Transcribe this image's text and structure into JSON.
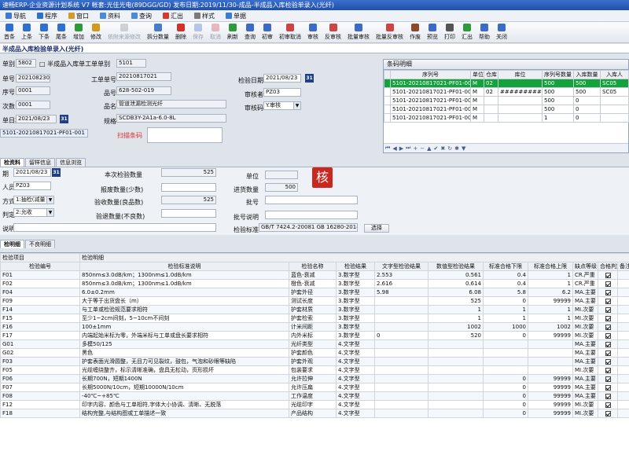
{
  "window": {
    "title": "速畅ERP-企业资源计划系统 V7 帐套:光佳光电(89DGG/GD) 发布日期:2019/11/30-成品-半成品入库检验单录入(光纤)"
  },
  "menu": [
    {
      "label": "导航",
      "icon": "nav-icon",
      "color": "#3d7bd6"
    },
    {
      "label": "程序",
      "icon": "program-icon",
      "color": "#2f6fc7"
    },
    {
      "label": "窗口",
      "icon": "window-icon",
      "color": "#d69a2c"
    },
    {
      "label": "资料",
      "icon": "data-icon",
      "color": "#4a8ad8"
    },
    {
      "label": "查询",
      "icon": "query-icon",
      "color": "#4a8ad8"
    },
    {
      "label": "汇出",
      "icon": "export-icon",
      "color": "#d43a2f"
    },
    {
      "label": "样式",
      "icon": "style-icon",
      "color": "#7a7a7a"
    },
    {
      "label": "单据",
      "icon": "bill-icon",
      "color": "#3d7bd6"
    }
  ],
  "toolbar": [
    {
      "label": "首条",
      "icon": "first-icon",
      "color": "#2e6fcf",
      "enabled": true
    },
    {
      "label": "上条",
      "icon": "prev-icon",
      "color": "#2e6fcf",
      "enabled": true
    },
    {
      "label": "下条",
      "icon": "next-icon",
      "color": "#2e6fcf",
      "enabled": true
    },
    {
      "label": "尾条",
      "icon": "last-icon",
      "color": "#2e6fcf",
      "enabled": true
    },
    {
      "label": "增加",
      "icon": "add-icon",
      "color": "#2f9a3c",
      "enabled": true
    },
    {
      "label": "修改",
      "icon": "edit-icon",
      "color": "#d19a1f",
      "enabled": true
    },
    {
      "label": "依附来源修改",
      "icon": "attach-edit-icon",
      "color": "#8a8a8a",
      "enabled": false
    },
    {
      "label": "拆分数量",
      "icon": "split-icon",
      "color": "#4a7bc6",
      "enabled": true
    },
    {
      "label": "删除",
      "icon": "delete-icon",
      "color": "#d2322a",
      "enabled": true
    },
    {
      "label": "保存",
      "icon": "save-icon",
      "color": "#3b6bc4",
      "enabled": false
    },
    {
      "label": "取消",
      "icon": "cancel-icon",
      "color": "#c44",
      "enabled": false
    },
    {
      "label": "刷新",
      "icon": "refresh-icon",
      "color": "#2f9a3c",
      "enabled": true
    },
    {
      "label": "查询",
      "icon": "search-icon",
      "color": "#3b6bc4",
      "enabled": true
    },
    {
      "label": "初审",
      "icon": "first-review-icon",
      "color": "#3b6bc4",
      "enabled": true
    },
    {
      "label": "初审取消",
      "icon": "first-review-cancel-icon",
      "color": "#c44",
      "enabled": true
    },
    {
      "label": "审核",
      "icon": "approve-icon",
      "color": "#3b6bc4",
      "enabled": true
    },
    {
      "label": "反审核",
      "icon": "unapprove-icon",
      "color": "#c44",
      "enabled": true
    },
    {
      "label": "批量审核",
      "icon": "batch-approve-icon",
      "color": "#3b6bc4",
      "enabled": true
    },
    {
      "label": "批量反审核",
      "icon": "batch-unapprove-icon",
      "color": "#c44",
      "enabled": true
    },
    {
      "label": "作废",
      "icon": "void-icon",
      "color": "#8a4b2a",
      "enabled": true
    },
    {
      "label": "预览",
      "icon": "preview-icon",
      "color": "#3b6bc4",
      "enabled": true
    },
    {
      "label": "打印",
      "icon": "print-icon",
      "color": "#555",
      "enabled": true
    },
    {
      "label": "汇出",
      "icon": "export-icon",
      "color": "#2f9a3c",
      "enabled": true
    },
    {
      "label": "帮助",
      "icon": "help-icon",
      "color": "#3b6bc4",
      "enabled": true
    },
    {
      "label": "关闭",
      "icon": "close-icon",
      "color": "#3b6bc4",
      "enabled": true
    }
  ],
  "form_title": "半成品入库检验单录入(光纤)",
  "header": {
    "l_type": "单别",
    "type": "5802",
    "l_wo_type": "半成品入库单工单单别",
    "wo_type": "5101",
    "l_order_no": "单号",
    "order_no": "20210823071",
    "l_wo_no": "工单单号",
    "wo_no": "20210817021",
    "l_check_date": "检验日期",
    "check_date": "2021/08/23",
    "l_seq": "序号",
    "seq": "0001",
    "l_part_no": "品号",
    "part_no": "628-502-019",
    "l_inspector": "审核者",
    "inspector": "PZ03",
    "l_count": "次数",
    "count": "0001",
    "l_part_name": "品名",
    "part_name": "管道泄漏检测光纤",
    "l_approve_code": "审核码",
    "approve_code": "Y.审核",
    "l_doc_date": "单日期",
    "doc_date": "2021/08/23",
    "l_spec": "规格",
    "spec": "SCDB3Y-2A1a-6.0-8L",
    "barcode_value": "5101-20210817021-PF01-001",
    "scan_label": "扫描条码",
    "calendar_icon": "calendar-icon"
  },
  "barcode_panel": {
    "title": "条码明细",
    "columns": [
      "",
      "序列号",
      "单位",
      "仓库",
      "库位",
      "序列号数量",
      "入库数量",
      "入库人"
    ],
    "rows": [
      [
        "",
        "5101-20210817021-PF01-001",
        "M",
        "02",
        "",
        "500",
        "500",
        "SC05"
      ],
      [
        "",
        "5101-20210817021-PF01-002",
        "M",
        "02",
        "#########",
        "500",
        "500",
        "SC05"
      ],
      [
        "",
        "5101-20210817021-PF01-003",
        "M",
        "",
        "",
        "500",
        "0",
        ""
      ],
      [
        "",
        "5101-20210817021-PF01-004",
        "M",
        "",
        "",
        "500",
        "0",
        ""
      ],
      [
        "",
        "5101-20210817021-PF01-005",
        "M",
        "",
        "",
        "1",
        "0",
        ""
      ]
    ],
    "nav": [
      "⏮",
      "◀",
      "▶",
      "⏭",
      "+",
      "−",
      "▲",
      "✔",
      "✖",
      "↻",
      "✱",
      "▼"
    ]
  },
  "tabs_mid": [
    "检资料",
    "留样信息",
    "信息浏览"
  ],
  "check": {
    "l_check_date": "期",
    "check_date": "2021/08/23",
    "l_qty": "本次检验数量",
    "qty": "525",
    "l_unit": "单位",
    "unit": "",
    "l_person": "人员",
    "person": "PZ03",
    "l_scrap": "报废数量(少数)",
    "scrap": "",
    "l_inqty": "进货数量",
    "inqty": "500",
    "l_method": "方式",
    "method": "1:抽检(减量",
    "l_okqty": "验收数量(良品数)",
    "okqty": "525",
    "l_batch": "批号",
    "batch": "",
    "l_judge": "判定",
    "judge": "2:允收",
    "l_ngqty": "验退数量(不良数)",
    "ngqty": "",
    "l_batch_desc": "批号说明",
    "batch_desc": "",
    "l_note": "说明",
    "note": "",
    "l_std": "检验标准",
    "std": "GB/T 7424.2-20081  GB 16280-2014",
    "select_label": "选择",
    "stamp": "核"
  },
  "tabs_bottom": [
    "检明细",
    "不良明细"
  ],
  "grid": {
    "group_left": "检验项目",
    "group_right": "检验明细",
    "columns": [
      "检验编号",
      "检验标准说明",
      "检验名称",
      "检验结果",
      "文字型检验结果",
      "数值型检验结果",
      "标准合格下限",
      "标准合格上限",
      "缺点等级",
      "合格判定",
      "备注"
    ],
    "rows": [
      [
        "F01",
        "850nm≤3.0dB/km；1300nm≤1.0dB/km",
        "蓝色-衰减",
        "3.数字型",
        "2.553",
        "0.561",
        "0.4",
        "1",
        "CR.严重",
        true,
        ""
      ],
      [
        "F02",
        "850nm≤3.0dB/km；1300nm≤1.0dB/km",
        "橙色-衰减",
        "3.数字型",
        "2.616",
        "0.614",
        "0.4",
        "1",
        "CR.严重",
        true,
        ""
      ],
      [
        "F04",
        "6.0±0.2mm",
        "护套外径",
        "3.数字型",
        "5.98",
        "6.08",
        "5.8",
        "6.2",
        "MA.主要",
        true,
        ""
      ],
      [
        "F09",
        "大于等于出货盘长（m）",
        "测试长度",
        "3.数字型",
        "",
        "525",
        "0",
        "99999",
        "MA.主要",
        true,
        ""
      ],
      [
        "F14",
        "与工单或检验规范要求相符",
        "护套材质",
        "3.数字型",
        "",
        "1",
        "1",
        "1",
        "MI.次要",
        true,
        ""
      ],
      [
        "F15",
        "至少1~2cm间刻，5~10cm不间刻",
        "护套检索",
        "3.数字型",
        "",
        "1",
        "1",
        "1",
        "MI.次要",
        true,
        ""
      ],
      [
        "F16",
        "100±1mm",
        "计米间距",
        "3.数字型",
        "",
        "1002",
        "1000",
        "1002",
        "MI.次要",
        true,
        ""
      ],
      [
        "F17",
        "内端起始米标为零，外端米标与工单或盘长要求相符",
        "内外米标",
        "3.数字型",
        "0",
        "520",
        "0",
        "99999",
        "MI.次要",
        true,
        ""
      ],
      [
        "G01",
        "多模50/125",
        "光纤类型",
        "4.文字型",
        "",
        "",
        "",
        "",
        "MA.主要",
        true,
        ""
      ],
      [
        "G02",
        "黑色",
        "护套颜色",
        "4.文字型",
        "",
        "",
        "",
        "",
        "MA.主要",
        true,
        ""
      ],
      [
        "F03",
        "护套表面光滑圆整，无目力可见裂纹，鼓包，气泡和砂眼等缺陷",
        "护套外观",
        "4.文字型",
        "",
        "",
        "",
        "",
        "MA.主要",
        true,
        ""
      ],
      [
        "F05",
        "光缆缠绕整齐，标示清晰准确，盘具无松动，页形损坏",
        "包装要求",
        "4.文字型",
        "",
        "",
        "",
        "",
        "MI.次要",
        true,
        ""
      ],
      [
        "F06",
        "长期700N，短期1400N",
        "允许拉伸",
        "4.文字型",
        "",
        "",
        "0",
        "99999",
        "MA.主要",
        true,
        ""
      ],
      [
        "F07",
        "长期5000N/10cm，短期10000N/10cm",
        "允许压扁",
        "4.文字型",
        "",
        "",
        "0",
        "99999",
        "MA.主要",
        true,
        ""
      ],
      [
        "F08",
        "-40℃~+85℃",
        "工作温度",
        "4.文字型",
        "",
        "",
        "0",
        "99999",
        "MA.主要",
        true,
        ""
      ],
      [
        "F12",
        "印字内容、颜色与工单相符,字体大小协调、清晰、无脱落",
        "光缆印字",
        "4.文字型",
        "",
        "",
        "0",
        "99999",
        "MI.次要",
        true,
        ""
      ],
      [
        "F18",
        "结构完整,与结构图或工单描述一致",
        "产品结构",
        "4.文字型",
        "",
        "",
        "0",
        "99999",
        "MI.次要",
        true,
        ""
      ]
    ]
  }
}
